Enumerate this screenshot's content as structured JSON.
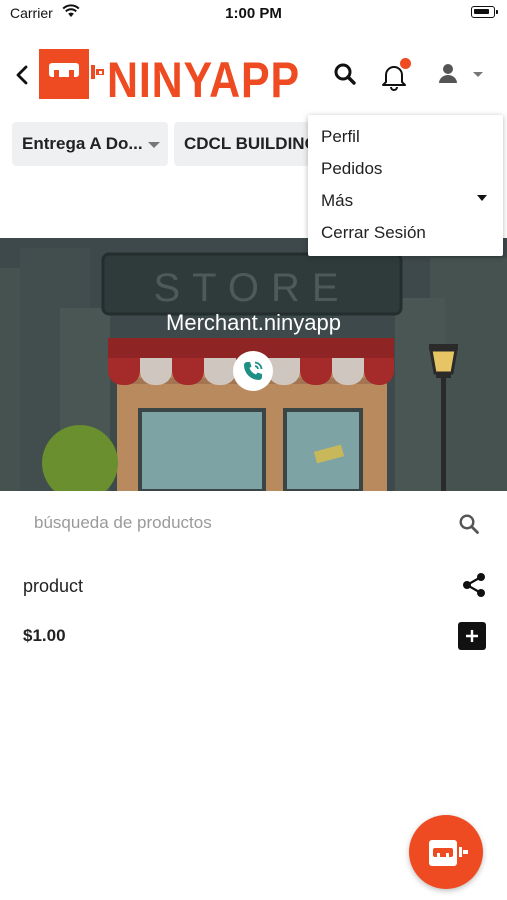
{
  "status_bar": {
    "carrier": "Carrier",
    "time": "1:00 PM"
  },
  "header": {
    "brand": "NINYAPP",
    "icons": [
      "back-icon",
      "search-icon",
      "bell-icon",
      "user-icon",
      "chevron-down-icon"
    ],
    "notification_dot_color": "#ef4b22"
  },
  "filters": {
    "delivery_label": "Entrega A Do...",
    "location_label": "CDCL BUILDING"
  },
  "user_menu": {
    "items": [
      "Perfil",
      "Pedidos",
      "Más",
      "Cerrar Sesión"
    ]
  },
  "store": {
    "merchant_name": "Merchant.ninyapp",
    "banner_sign": "STORE"
  },
  "search": {
    "placeholder": "búsqueda de productos",
    "value": ""
  },
  "product": {
    "name": "product",
    "price": "$1.00"
  },
  "colors": {
    "brand": "#ef4b22",
    "dark": "#111111",
    "chip_bg": "#eef0f2"
  }
}
